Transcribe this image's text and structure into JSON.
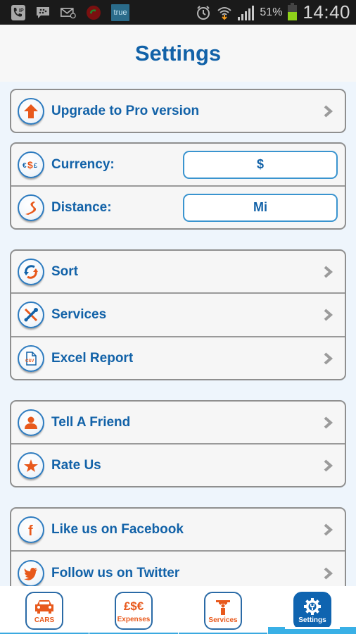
{
  "status_bar": {
    "left_icons": [
      "phone-ip-icon",
      "bbm-chat-icon",
      "email-icon",
      "missed-call-icon",
      "true-app-icon"
    ],
    "true_label": "true",
    "ip_label": "IP",
    "battery_percent_text": "51%",
    "battery_level": 0.51,
    "time": "14:40",
    "right_icons": [
      "alarm-icon",
      "wifi-icon",
      "signal-icon",
      "battery-icon"
    ]
  },
  "header": {
    "title": "Settings"
  },
  "groups": {
    "upgrade": {
      "items": [
        {
          "label": "Upgrade to Pro version",
          "icon": "upgrade-arrow-icon"
        }
      ]
    },
    "units": {
      "items": [
        {
          "label": "Currency:",
          "icon": "currency-icon",
          "value": "$"
        },
        {
          "label": "Distance:",
          "icon": "road-icon",
          "value": "Mi"
        }
      ]
    },
    "tools": {
      "items": [
        {
          "label": "Sort",
          "icon": "sort-refresh-icon"
        },
        {
          "label": "Services",
          "icon": "tools-icon"
        },
        {
          "label": "Excel Report",
          "icon": "csv-file-icon"
        }
      ]
    },
    "social": {
      "items": [
        {
          "label": "Tell A Friend",
          "icon": "person-icon"
        },
        {
          "label": "Rate Us",
          "icon": "stars-icon"
        }
      ]
    },
    "follow": {
      "items": [
        {
          "label": "Like us on Facebook",
          "icon": "facebook-icon"
        },
        {
          "label": "Follow us on Twitter",
          "icon": "twitter-icon"
        }
      ]
    }
  },
  "tabbar": {
    "tabs": [
      {
        "label": "CARS",
        "icon": "car-icon",
        "active": false
      },
      {
        "label": "Expenses",
        "icon": "currency-symbols-icon",
        "symbols": "£$€",
        "active": false
      },
      {
        "label": "Services",
        "icon": "mechanic-wrench-icon",
        "active": false
      },
      {
        "label": "Settings",
        "icon": "gear-wrench-icon",
        "active": true
      }
    ]
  },
  "colors": {
    "primary_blue": "#1262a8",
    "accent_orange": "#e8591c",
    "tab_highlight": "#39b0e6",
    "background": "#eef5fc"
  }
}
